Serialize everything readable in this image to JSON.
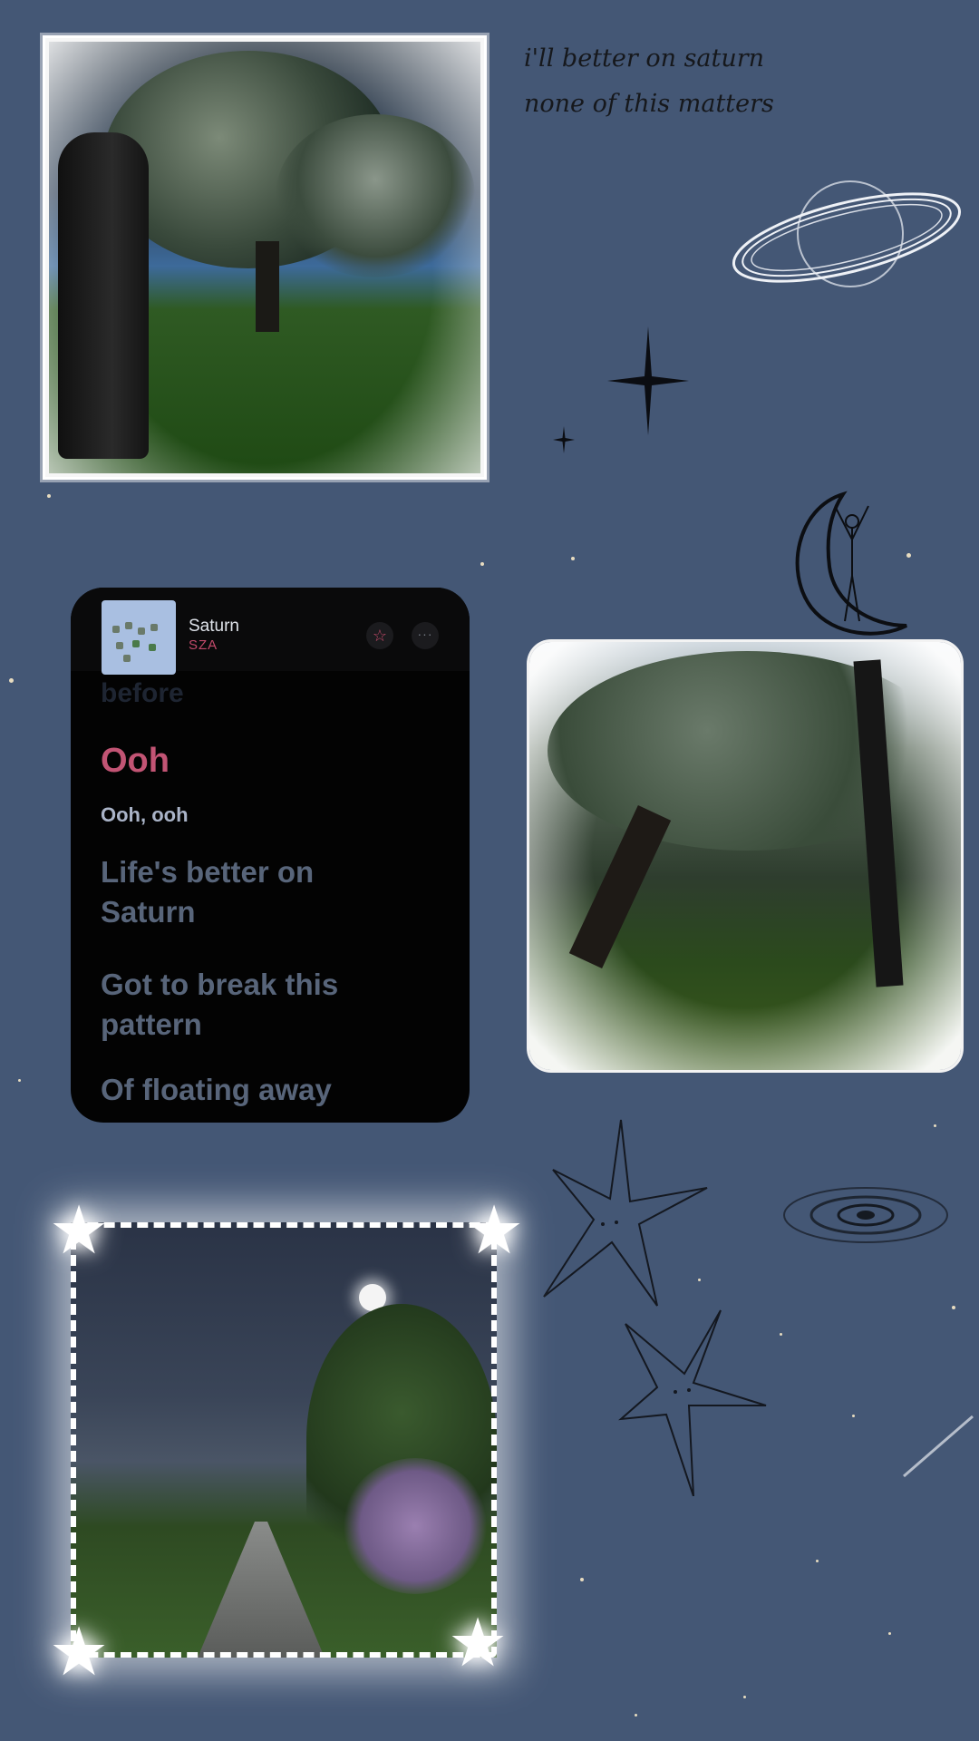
{
  "quote": {
    "line1": "i'll better on saturn",
    "line2": "none of this matters"
  },
  "player": {
    "song_title": "Saturn",
    "artist": "SZA",
    "favorite_icon": "star-outline-icon",
    "more_icon": "more-icon",
    "more_glyph": "···",
    "favorite_glyph": "☆"
  },
  "lyrics": {
    "previous": "before",
    "current": "Ooh",
    "current_sub": "Ooh, ooh",
    "next_1": "Life's better on Saturn",
    "next_2": "Got to break this pattern",
    "next_3": "Of floating away"
  },
  "decorations": {
    "glow_star_glyph": "★",
    "accent_color": "#c25474",
    "background_color": "#445775"
  }
}
